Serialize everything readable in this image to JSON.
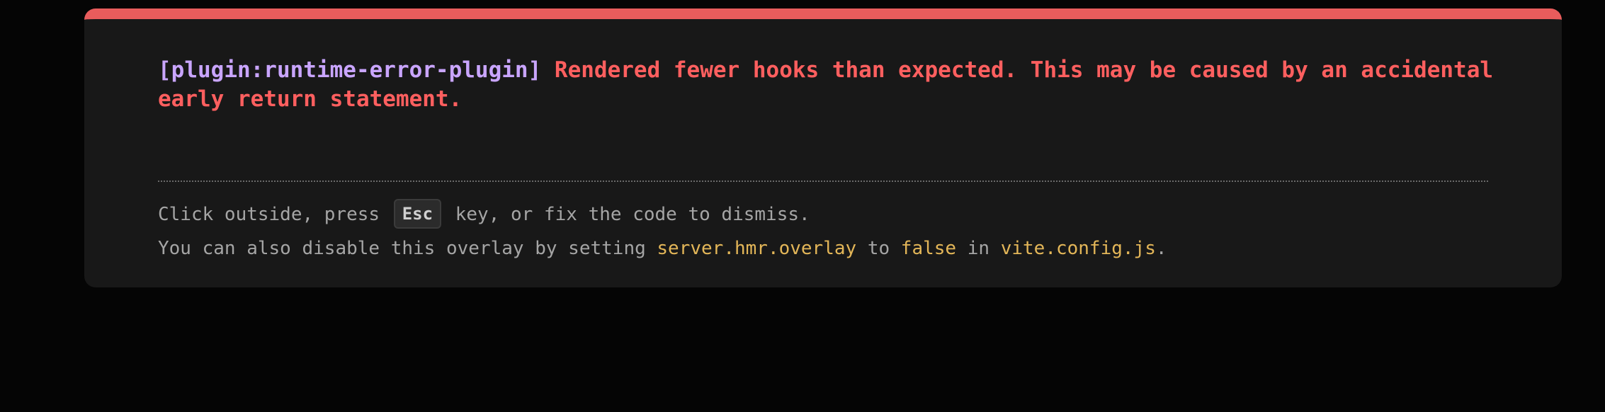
{
  "error": {
    "plugin_tag": "[plugin:runtime-error-plugin]",
    "message": "Rendered fewer hooks than expected. This may be caused by an accidental early return statement."
  },
  "tip": {
    "line1_before": "Click outside, press",
    "key_label": "Esc",
    "line1_after": "key, or fix the code to dismiss.",
    "line2_prefix": "You can also disable this overlay by setting",
    "setting_name": "server.hmr.overlay",
    "to_text": "to",
    "setting_value": "false",
    "in_text": "in",
    "config_file": "vite.config.js",
    "period": "."
  },
  "colors": {
    "page_background": "#050505",
    "panel_background": "#181818",
    "top_border": "#e85c5c",
    "error_text": "#ff5f5f",
    "plugin_text": "#c9a5ff",
    "tip_text": "#a5a5a5",
    "code_highlight": "#e3b658"
  }
}
